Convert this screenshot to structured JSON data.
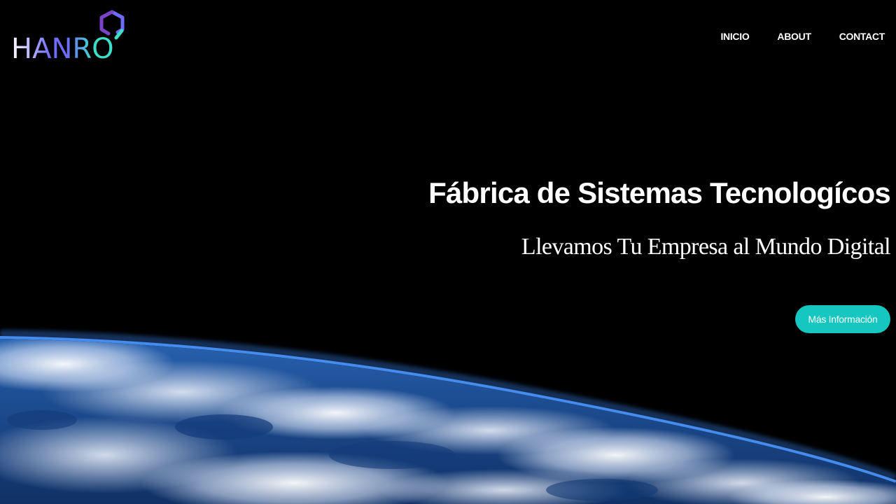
{
  "brand": {
    "logo_text": "HANRO",
    "logo_icon": "hexagon-ring-icon"
  },
  "nav": {
    "items": [
      {
        "label": "INICIO"
      },
      {
        "label": "ABOUT"
      },
      {
        "label": "CONTACT"
      }
    ]
  },
  "hero": {
    "title": "Fábrica de Sistemas Tecnologícos",
    "subtitle": "Llevamos Tu Empresa al Mundo Digital",
    "cta_label": "Más Información",
    "background": "earth-from-space-image"
  },
  "colors": {
    "background": "#000000",
    "accent": "#15c7c0",
    "logo_purple": "#6f6bff",
    "logo_teal": "#3de0c6"
  }
}
